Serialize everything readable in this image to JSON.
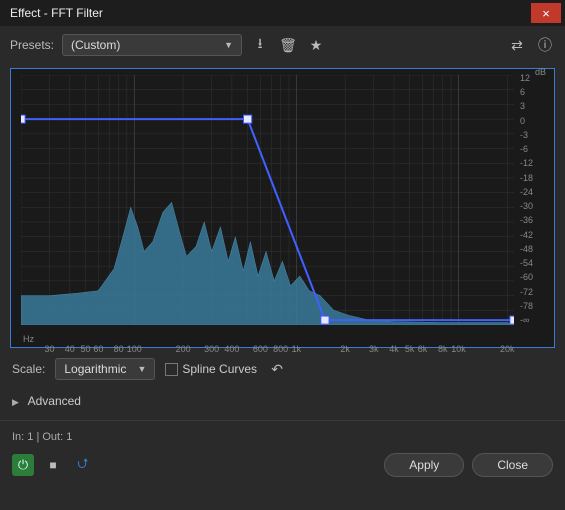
{
  "window": {
    "title": "Effect - FFT Filter"
  },
  "presets": {
    "label": "Presets:",
    "value": "(Custom)"
  },
  "scale": {
    "label": "Scale:",
    "value": "Logarithmic"
  },
  "spline": {
    "label": "Spline Curves",
    "checked": false
  },
  "advanced": {
    "label": "Advanced"
  },
  "io": {
    "text": "In: 1 | Out: 1"
  },
  "buttons": {
    "apply": "Apply",
    "close": "Close"
  },
  "chart_data": {
    "type": "line",
    "title": "FFT Filter",
    "xlabel": "Hz",
    "ylabel": "dB",
    "x_scale": "log",
    "xlim": [
      20,
      22000
    ],
    "ylim": [
      -96,
      12
    ],
    "y_ticks": [
      12,
      6,
      3,
      0,
      -3,
      -6,
      -12,
      -18,
      -24,
      -30,
      -36,
      -42,
      -48,
      -54,
      -60,
      -72,
      -78,
      "-∞"
    ],
    "x_ticks": [
      30,
      40,
      50,
      60,
      80,
      100,
      200,
      300,
      400,
      600,
      800,
      "1k",
      "2k",
      "3k",
      "4k",
      "5k",
      "6k",
      "8k",
      "10k",
      "20k"
    ],
    "series": [
      {
        "name": "filter-curve",
        "points": [
          {
            "hz": 20,
            "db": 0
          },
          {
            "hz": 500,
            "db": 0
          },
          {
            "hz": 1500,
            "db": -90
          },
          {
            "hz": 22000,
            "db": -90
          }
        ]
      }
    ],
    "spectrum": [
      {
        "hz": 20,
        "db": -72
      },
      {
        "hz": 30,
        "db": -72
      },
      {
        "hz": 45,
        "db": -70
      },
      {
        "hz": 60,
        "db": -68
      },
      {
        "hz": 75,
        "db": -55
      },
      {
        "hz": 85,
        "db": -42
      },
      {
        "hz": 95,
        "db": -30
      },
      {
        "hz": 105,
        "db": -38
      },
      {
        "hz": 115,
        "db": -48
      },
      {
        "hz": 130,
        "db": -44
      },
      {
        "hz": 150,
        "db": -32
      },
      {
        "hz": 170,
        "db": -28
      },
      {
        "hz": 190,
        "db": -40
      },
      {
        "hz": 210,
        "db": -50
      },
      {
        "hz": 240,
        "db": -46
      },
      {
        "hz": 270,
        "db": -36
      },
      {
        "hz": 300,
        "db": -48
      },
      {
        "hz": 340,
        "db": -38
      },
      {
        "hz": 380,
        "db": -52
      },
      {
        "hz": 420,
        "db": -42
      },
      {
        "hz": 470,
        "db": -56
      },
      {
        "hz": 520,
        "db": -44
      },
      {
        "hz": 580,
        "db": -58
      },
      {
        "hz": 650,
        "db": -48
      },
      {
        "hz": 730,
        "db": -60
      },
      {
        "hz": 820,
        "db": -52
      },
      {
        "hz": 920,
        "db": -64
      },
      {
        "hz": 1050,
        "db": -58
      },
      {
        "hz": 1200,
        "db": -68
      },
      {
        "hz": 1400,
        "db": -72
      },
      {
        "hz": 1700,
        "db": -78
      },
      {
        "hz": 2100,
        "db": -84
      },
      {
        "hz": 2800,
        "db": -90
      },
      {
        "hz": 4000,
        "db": -92
      },
      {
        "hz": 8000,
        "db": -93
      },
      {
        "hz": 20000,
        "db": -93
      }
    ]
  }
}
